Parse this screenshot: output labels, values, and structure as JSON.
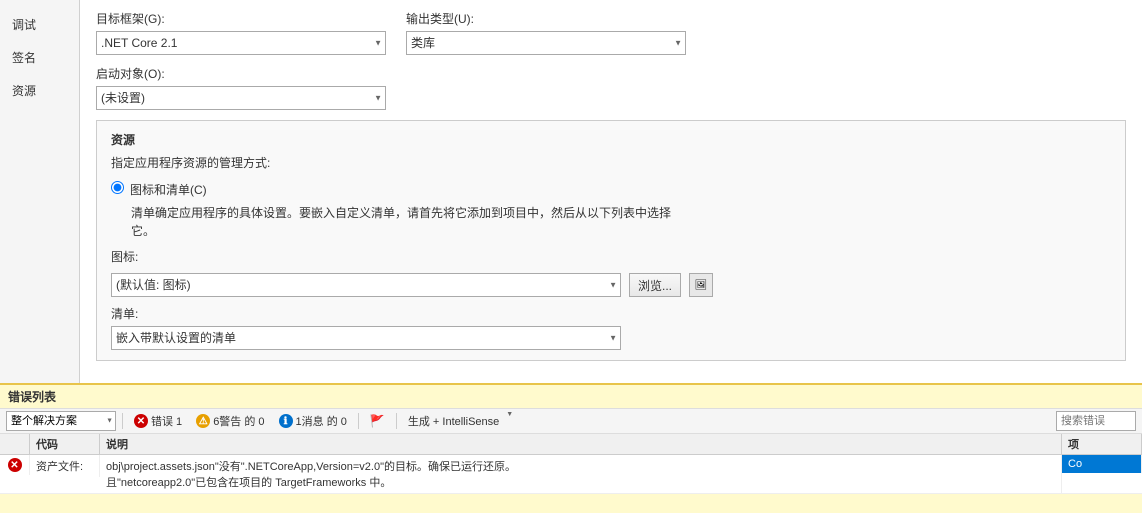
{
  "sidebar": {
    "items": [
      {
        "id": "debug",
        "label": "调试"
      },
      {
        "id": "sign",
        "label": "签名"
      },
      {
        "id": "resources",
        "label": "资源"
      }
    ]
  },
  "form": {
    "target_framework_label": "目标框架(G):",
    "target_framework_value": ".NET Core 2.1",
    "output_type_label": "输出类型(U):",
    "output_type_value": "类库",
    "startup_object_label": "启动对象(O):",
    "startup_object_value": "(未设置)",
    "resources_box": {
      "title": "资源",
      "desc": "指定应用程序资源的管理方式:",
      "radio_label": "图标和清单(C)",
      "radio_desc_line1": "清单确定应用程序的具体设置。要嵌入自定义清单，请首先将它添加到项目中，然后从以下列表中选择",
      "radio_desc_line2": "它。",
      "icon_label": "图标:",
      "icon_value": "(默认值: 图标)",
      "browse_btn": "浏览...",
      "list_label": "清单:",
      "list_value": "嵌入带默认设置的清单"
    }
  },
  "error_section": {
    "title": "错误列表",
    "filter_option": "整个解决方案",
    "errors": {
      "label": "错误",
      "count": "1",
      "icon_char": "✕"
    },
    "warnings": {
      "label": "警告",
      "count": "6",
      "text": "6警告 的 0"
    },
    "messages": {
      "label": "消息",
      "count": "1",
      "text": "1消息 的 0"
    },
    "build_filter_label": "生成 + IntelliSense",
    "search_placeholder": "搜索错误",
    "columns": {
      "icon": "",
      "code": "代码",
      "desc": "说明",
      "proj": "项"
    },
    "rows": [
      {
        "icon": "✕",
        "code": "资产文件:",
        "desc": "obj\\project.assets.json\"没有\".NETCoreApp,Version=v2.0\"的目标。确保已运行还原。",
        "extra": "且\"netcoreapp2.0\"已包含在项目的 TargetFrameworks 中。",
        "suffix": "Co"
      }
    ]
  }
}
